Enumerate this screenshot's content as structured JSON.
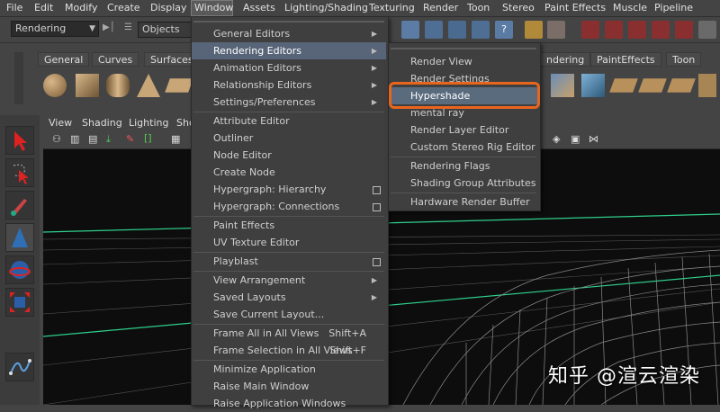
{
  "menubar": {
    "items": [
      "File",
      "Edit",
      "Modify",
      "Create",
      "Display",
      "Window",
      "Assets",
      "Lighting/Shading",
      "Texturing",
      "Render",
      "Toon",
      "Stereo",
      "Paint Effects",
      "Muscle",
      "Pipeline Cache"
    ]
  },
  "statusline": {
    "mode_dropdown": "Rendering",
    "selection_dropdown": "Objects"
  },
  "shelf": {
    "tabs": [
      "General",
      "Curves",
      "Surfaces",
      "ndering",
      "PaintEffects",
      "Toon"
    ]
  },
  "panel": {
    "menus": [
      "View",
      "Shading",
      "Lighting",
      "Sho"
    ]
  },
  "window_menu": {
    "items": [
      {
        "label": "General Editors",
        "type": "sub"
      },
      {
        "label": "Rendering Editors",
        "type": "sub"
      },
      {
        "label": "Animation Editors",
        "type": "sub"
      },
      {
        "label": "Relationship Editors",
        "type": "sub"
      },
      {
        "label": "Settings/Preferences",
        "type": "sub"
      },
      {
        "label": "Attribute Editor",
        "type": "plain"
      },
      {
        "label": "Outliner",
        "type": "plain"
      },
      {
        "label": "Node Editor",
        "type": "plain"
      },
      {
        "label": "Create Node",
        "type": "plain"
      },
      {
        "label": "Hypergraph: Hierarchy",
        "type": "box"
      },
      {
        "label": "Hypergraph: Connections",
        "type": "box"
      },
      {
        "label": "Paint Effects",
        "type": "plain"
      },
      {
        "label": "UV Texture Editor",
        "type": "plain"
      },
      {
        "label": "Playblast",
        "type": "box"
      },
      {
        "label": "View Arrangement",
        "type": "sub"
      },
      {
        "label": "Saved Layouts",
        "type": "sub"
      },
      {
        "label": "Save Current Layout...",
        "type": "plain"
      },
      {
        "label": "Frame All in All Views",
        "type": "shortcut",
        "shortcut": "Shift+A"
      },
      {
        "label": "Frame Selection in All Views",
        "type": "shortcut",
        "shortcut": "Shift+F"
      },
      {
        "label": "Minimize Application",
        "type": "plain"
      },
      {
        "label": "Raise Main Window",
        "type": "plain"
      },
      {
        "label": "Raise Application Windows",
        "type": "plain"
      }
    ]
  },
  "rendering_editors_menu": {
    "items": [
      "Render View",
      "Render Settings",
      "Hypershade",
      "mental ray",
      "Render Layer Editor",
      "Custom Stereo Rig Editor",
      "Rendering Flags",
      "Shading Group Attributes",
      "Hardware Render Buffer"
    ],
    "highlighted": "Hypershade"
  },
  "watermark": "知乎 @渲云渲染",
  "colors": {
    "highlight": "#5a6b7e",
    "callout": "#e8651e",
    "wireframe": "#2fcf8a"
  }
}
